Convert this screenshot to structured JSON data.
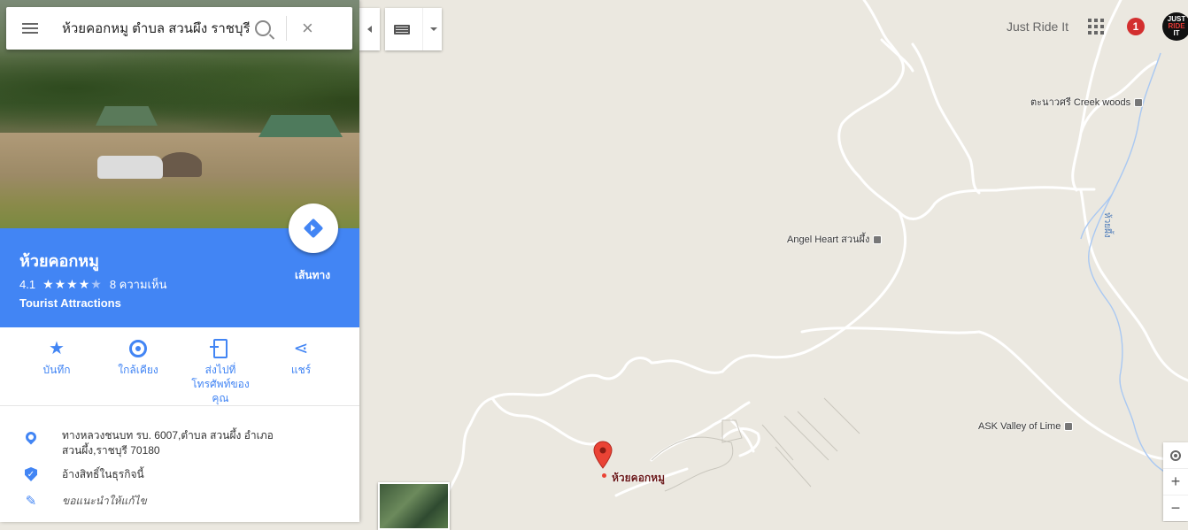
{
  "search": {
    "query": "ห้วยคอกหมู ตำบล สวนผึ้ง ราชบุรี"
  },
  "place": {
    "title": "ห้วยคอกหมู",
    "rating": "4.1",
    "stars_filled": 4,
    "reviews": "8 ความเห็น",
    "category": "Tourist Attractions",
    "directions_label": "เส้นทาง"
  },
  "actions": [
    {
      "label": "บันทึก",
      "icon": "star-icon"
    },
    {
      "label": "ใกล้เคียง",
      "icon": "nearby-icon"
    },
    {
      "label": "ส่งไปที่โทรศัพท์ของคุณ",
      "icon": "send-to-phone-icon"
    },
    {
      "label": "แชร์",
      "icon": "share-icon"
    }
  ],
  "details": {
    "address": "ทางหลวงชนบท รบ. 6007,ตำบล สวนผึ้ง อำเภอ สวนผึ้ง,ราชบุรี 70180",
    "claim": "อ้างสิทธิ์ในธุรกิจนี้",
    "suggest": "ขอแนะนำให้แก้ไข"
  },
  "account": {
    "name": "Just Ride It",
    "notifications": "1",
    "avatar_text": [
      "JUST",
      "RIDE",
      "IT"
    ]
  },
  "map": {
    "labels": {
      "creek_woods": "ตะนาวศรี Creek woods",
      "angel_heart": "Angel Heart สวนผึ้ง",
      "ask_valley": "ASK Valley of Lime",
      "pin": "ห้วยคอกหมู",
      "stream": "ห้วยผึ้ง"
    },
    "zoom_in": "+",
    "zoom_out": "−"
  },
  "colors": {
    "accent": "#4285f4",
    "map_bg": "#ebe8e0",
    "pin": "#ea4335",
    "notification": "#d32f2f"
  }
}
